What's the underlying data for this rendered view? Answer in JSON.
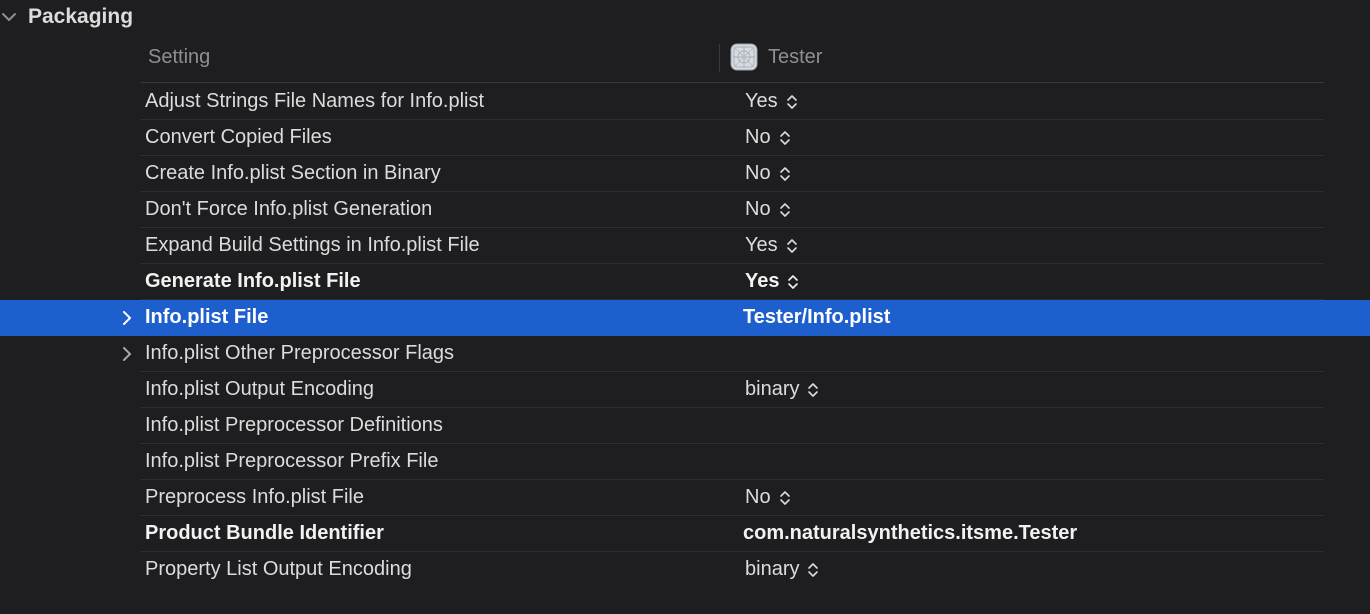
{
  "section": {
    "title": "Packaging"
  },
  "columns": {
    "setting": "Setting",
    "target": "Tester"
  },
  "rows": [
    {
      "name": "Adjust Strings File Names for Info.plist",
      "value": "Yes"
    },
    {
      "name": "Convert Copied Files",
      "value": "No"
    },
    {
      "name": "Create Info.plist Section in Binary",
      "value": "No"
    },
    {
      "name": "Don't Force Info.plist Generation",
      "value": "No"
    },
    {
      "name": "Expand Build Settings in Info.plist File",
      "value": "Yes"
    },
    {
      "name": "Generate Info.plist File",
      "value": "Yes"
    },
    {
      "name": "Info.plist File",
      "value": "Tester/Info.plist"
    },
    {
      "name": "Info.plist Other Preprocessor Flags",
      "value": ""
    },
    {
      "name": "Info.plist Output Encoding",
      "value": "binary"
    },
    {
      "name": "Info.plist Preprocessor Definitions",
      "value": ""
    },
    {
      "name": "Info.plist Preprocessor Prefix File",
      "value": ""
    },
    {
      "name": "Preprocess Info.plist File",
      "value": "No"
    },
    {
      "name": "Product Bundle Identifier",
      "value": "com.naturalsynthetics.itsme.Tester"
    },
    {
      "name": "Property List Output Encoding",
      "value": "binary"
    }
  ],
  "colors": {
    "background": "#1e1e21",
    "selection": "#1e5fce",
    "text": "#dcdcdc",
    "muted": "#8e8e93"
  }
}
